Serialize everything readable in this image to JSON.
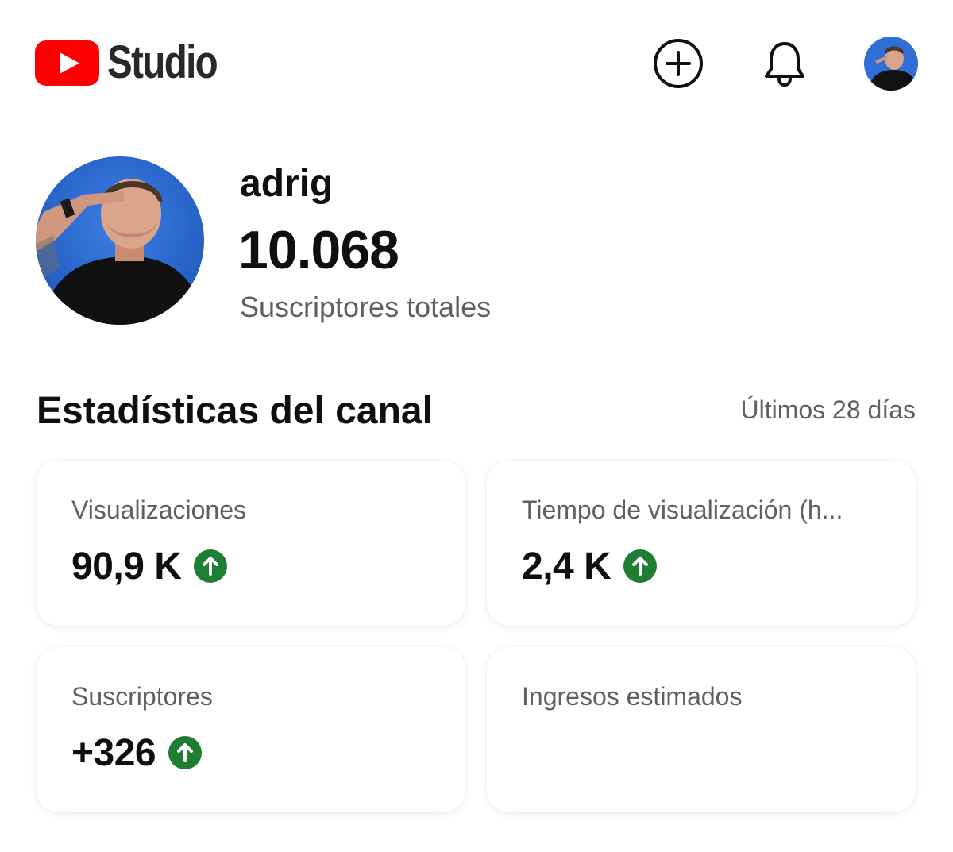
{
  "header": {
    "logo_text": "Studio",
    "icons": [
      "youtube-play-icon",
      "create-plus-icon",
      "bell-icon",
      "profile-avatar"
    ]
  },
  "channel": {
    "name": "adrig",
    "subscribers": "10.068",
    "subscribers_label": "Suscriptores totales"
  },
  "stats": {
    "title": "Estadísticas del canal",
    "period": "Últimos 28 días",
    "cards": [
      {
        "label": "Visualizaciones",
        "value": "90,9 K",
        "trend": "up"
      },
      {
        "label": "Tiempo de visualización (h...",
        "value": "2,4 K",
        "trend": "up"
      },
      {
        "label": "Suscriptores",
        "value": "+326",
        "trend": "up"
      },
      {
        "label": "Ingresos estimados",
        "value": "",
        "trend": "hidden"
      }
    ]
  },
  "colors": {
    "youtube_red": "#ff0000",
    "trend_up_green": "#1e7e34",
    "avatar_blue": "#2f6fd6",
    "text_primary": "#0f0f0f",
    "text_secondary": "#606060"
  }
}
